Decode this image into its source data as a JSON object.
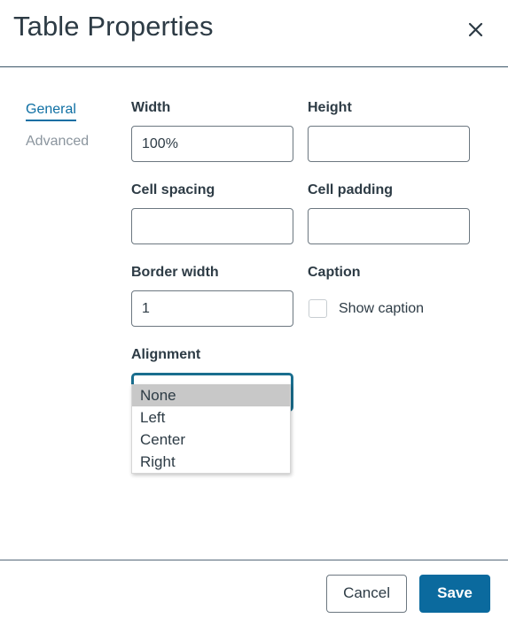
{
  "dialog": {
    "title": "Table Properties",
    "close_label": "Close",
    "close_icon": "close-icon"
  },
  "tabs": [
    {
      "label": "General",
      "active": true
    },
    {
      "label": "Advanced",
      "active": false
    }
  ],
  "form": {
    "width": {
      "label": "Width",
      "value": "100%",
      "placeholder": ""
    },
    "height": {
      "label": "Height",
      "value": "",
      "placeholder": ""
    },
    "cell_spacing": {
      "label": "Cell spacing",
      "value": "",
      "placeholder": ""
    },
    "cell_padding": {
      "label": "Cell padding",
      "value": "",
      "placeholder": ""
    },
    "border_width": {
      "label": "Border width",
      "value": "1",
      "placeholder": ""
    },
    "caption": {
      "label": "Caption",
      "checkbox_label": "Show caption",
      "checked": false
    },
    "alignment": {
      "label": "Alignment",
      "value": "None",
      "expanded": true,
      "chevron_icon": "chevron-down-icon",
      "options": [
        {
          "label": "None",
          "highlighted": true
        },
        {
          "label": "Left",
          "highlighted": false
        },
        {
          "label": "Center",
          "highlighted": false
        },
        {
          "label": "Right",
          "highlighted": false
        }
      ]
    }
  },
  "footer": {
    "cancel_label": "Cancel",
    "save_label": "Save"
  },
  "colors": {
    "accent_blue": "#0e6fa3",
    "save_blue": "#0b6a9e",
    "focus_teal": "#1a6e8e",
    "text": "#2d3b45",
    "muted_text": "#8b959e",
    "input_border": "#6c7780",
    "option_highlight": "#c8c8c8"
  }
}
